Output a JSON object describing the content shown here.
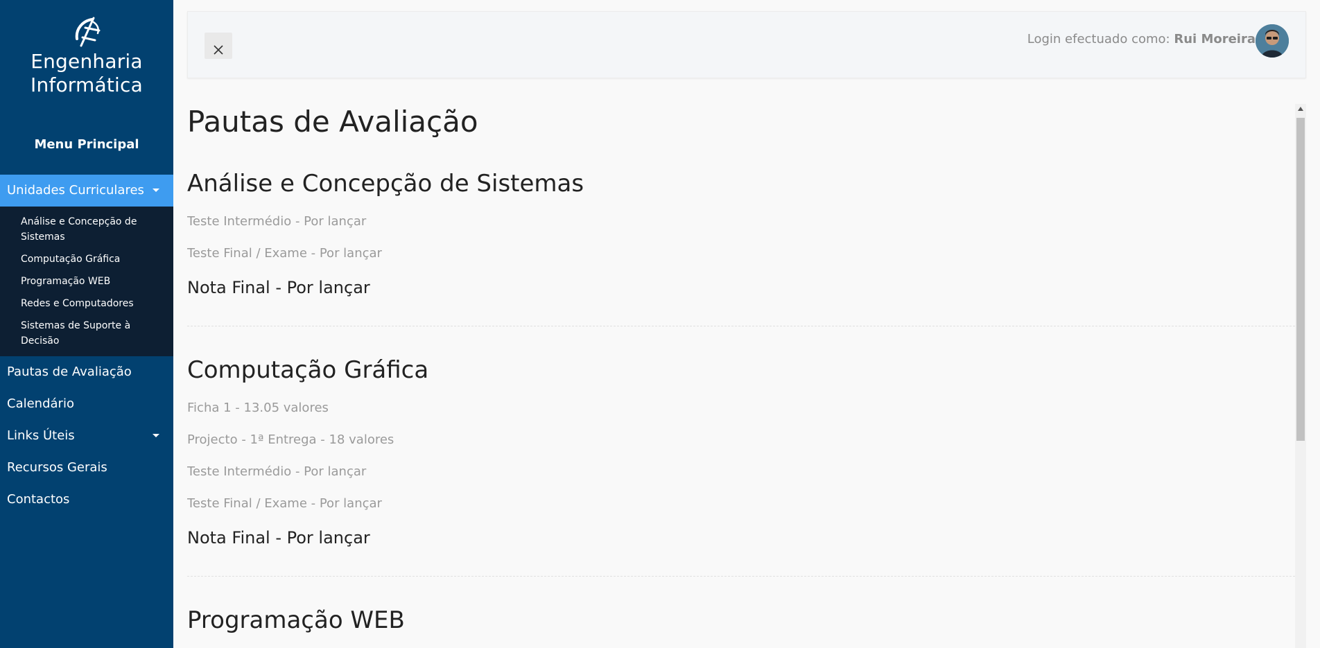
{
  "sidebar": {
    "brand_title": "Engenharia Informática",
    "menu_title": "Menu Principal",
    "items": [
      {
        "label": "Unidades Curriculares",
        "active": true,
        "has_caret": true
      },
      {
        "label": "Pautas de Avaliação",
        "active": false
      },
      {
        "label": "Calendário",
        "active": false
      },
      {
        "label": "Links Úteis",
        "active": false,
        "has_caret": true
      },
      {
        "label": "Recursos Gerais",
        "active": false
      },
      {
        "label": "Contactos",
        "active": false
      }
    ],
    "subitems": [
      "Análise e Concepção de Sistemas",
      "Computação Gráfica",
      "Programação WEB",
      "Redes e Computadores",
      "Sistemas de Suporte à Decisão"
    ]
  },
  "topbar": {
    "login_prefix": "Login efectuado como:",
    "user_name": "Rui Moreira"
  },
  "main": {
    "page_title": "Pautas de Avaliação",
    "courses": [
      {
        "title": "Análise e Concepção de Sistemas",
        "grades": [
          "Teste Intermédio - Por lançar",
          "Teste Final / Exame - Por lançar"
        ],
        "final": "Nota Final - Por lançar"
      },
      {
        "title": "Computação Gráfica",
        "grades": [
          "Ficha 1 - 13.05 valores",
          "Projecto - 1ª Entrega - 18 valores",
          "Teste Intermédio - Por lançar",
          "Teste Final / Exame - Por lançar"
        ],
        "final": "Nota Final - Por lançar"
      },
      {
        "title": "Programação WEB"
      }
    ]
  },
  "colors": {
    "sidebar_bg": "#024170",
    "active_item": "#3e9cf0",
    "submenu_bg": "#0d1f33"
  }
}
